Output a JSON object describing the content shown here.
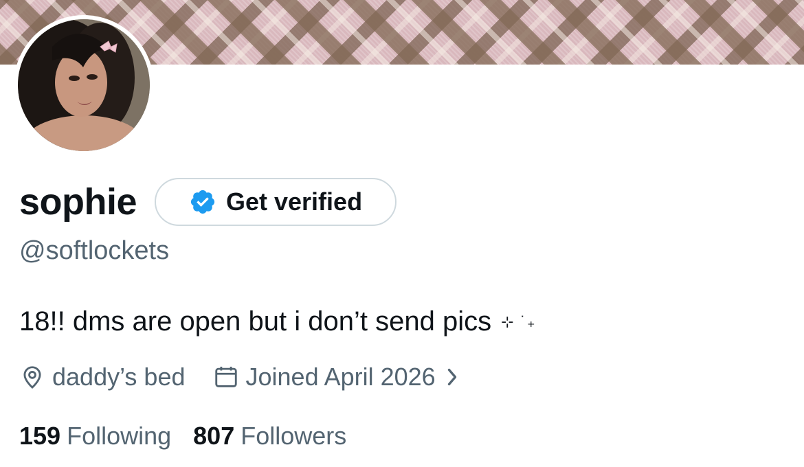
{
  "profile": {
    "display_name": "sophie",
    "handle": "@softlockets",
    "bio": "18!! dms are open but i don’t send pics",
    "bio_sparkles": "⊹ ˙₊",
    "location": "daddy’s bed",
    "joined": "Joined April 2026"
  },
  "verify_button": {
    "label": "Get verified"
  },
  "stats": {
    "following_count": "159",
    "following_label": "Following",
    "followers_count": "807",
    "followers_label": "Followers"
  },
  "icons": {
    "verified": "verified-badge-icon",
    "location": "location-pin-icon",
    "calendar": "calendar-icon",
    "chevron": "chevron-right-icon"
  },
  "colors": {
    "primary_text": "#0f1419",
    "secondary_text": "#536471",
    "verified_blue": "#1d9bf0",
    "button_border": "#cfd9de",
    "banner_pink": "#d9b8bd",
    "banner_brown": "#826955"
  }
}
